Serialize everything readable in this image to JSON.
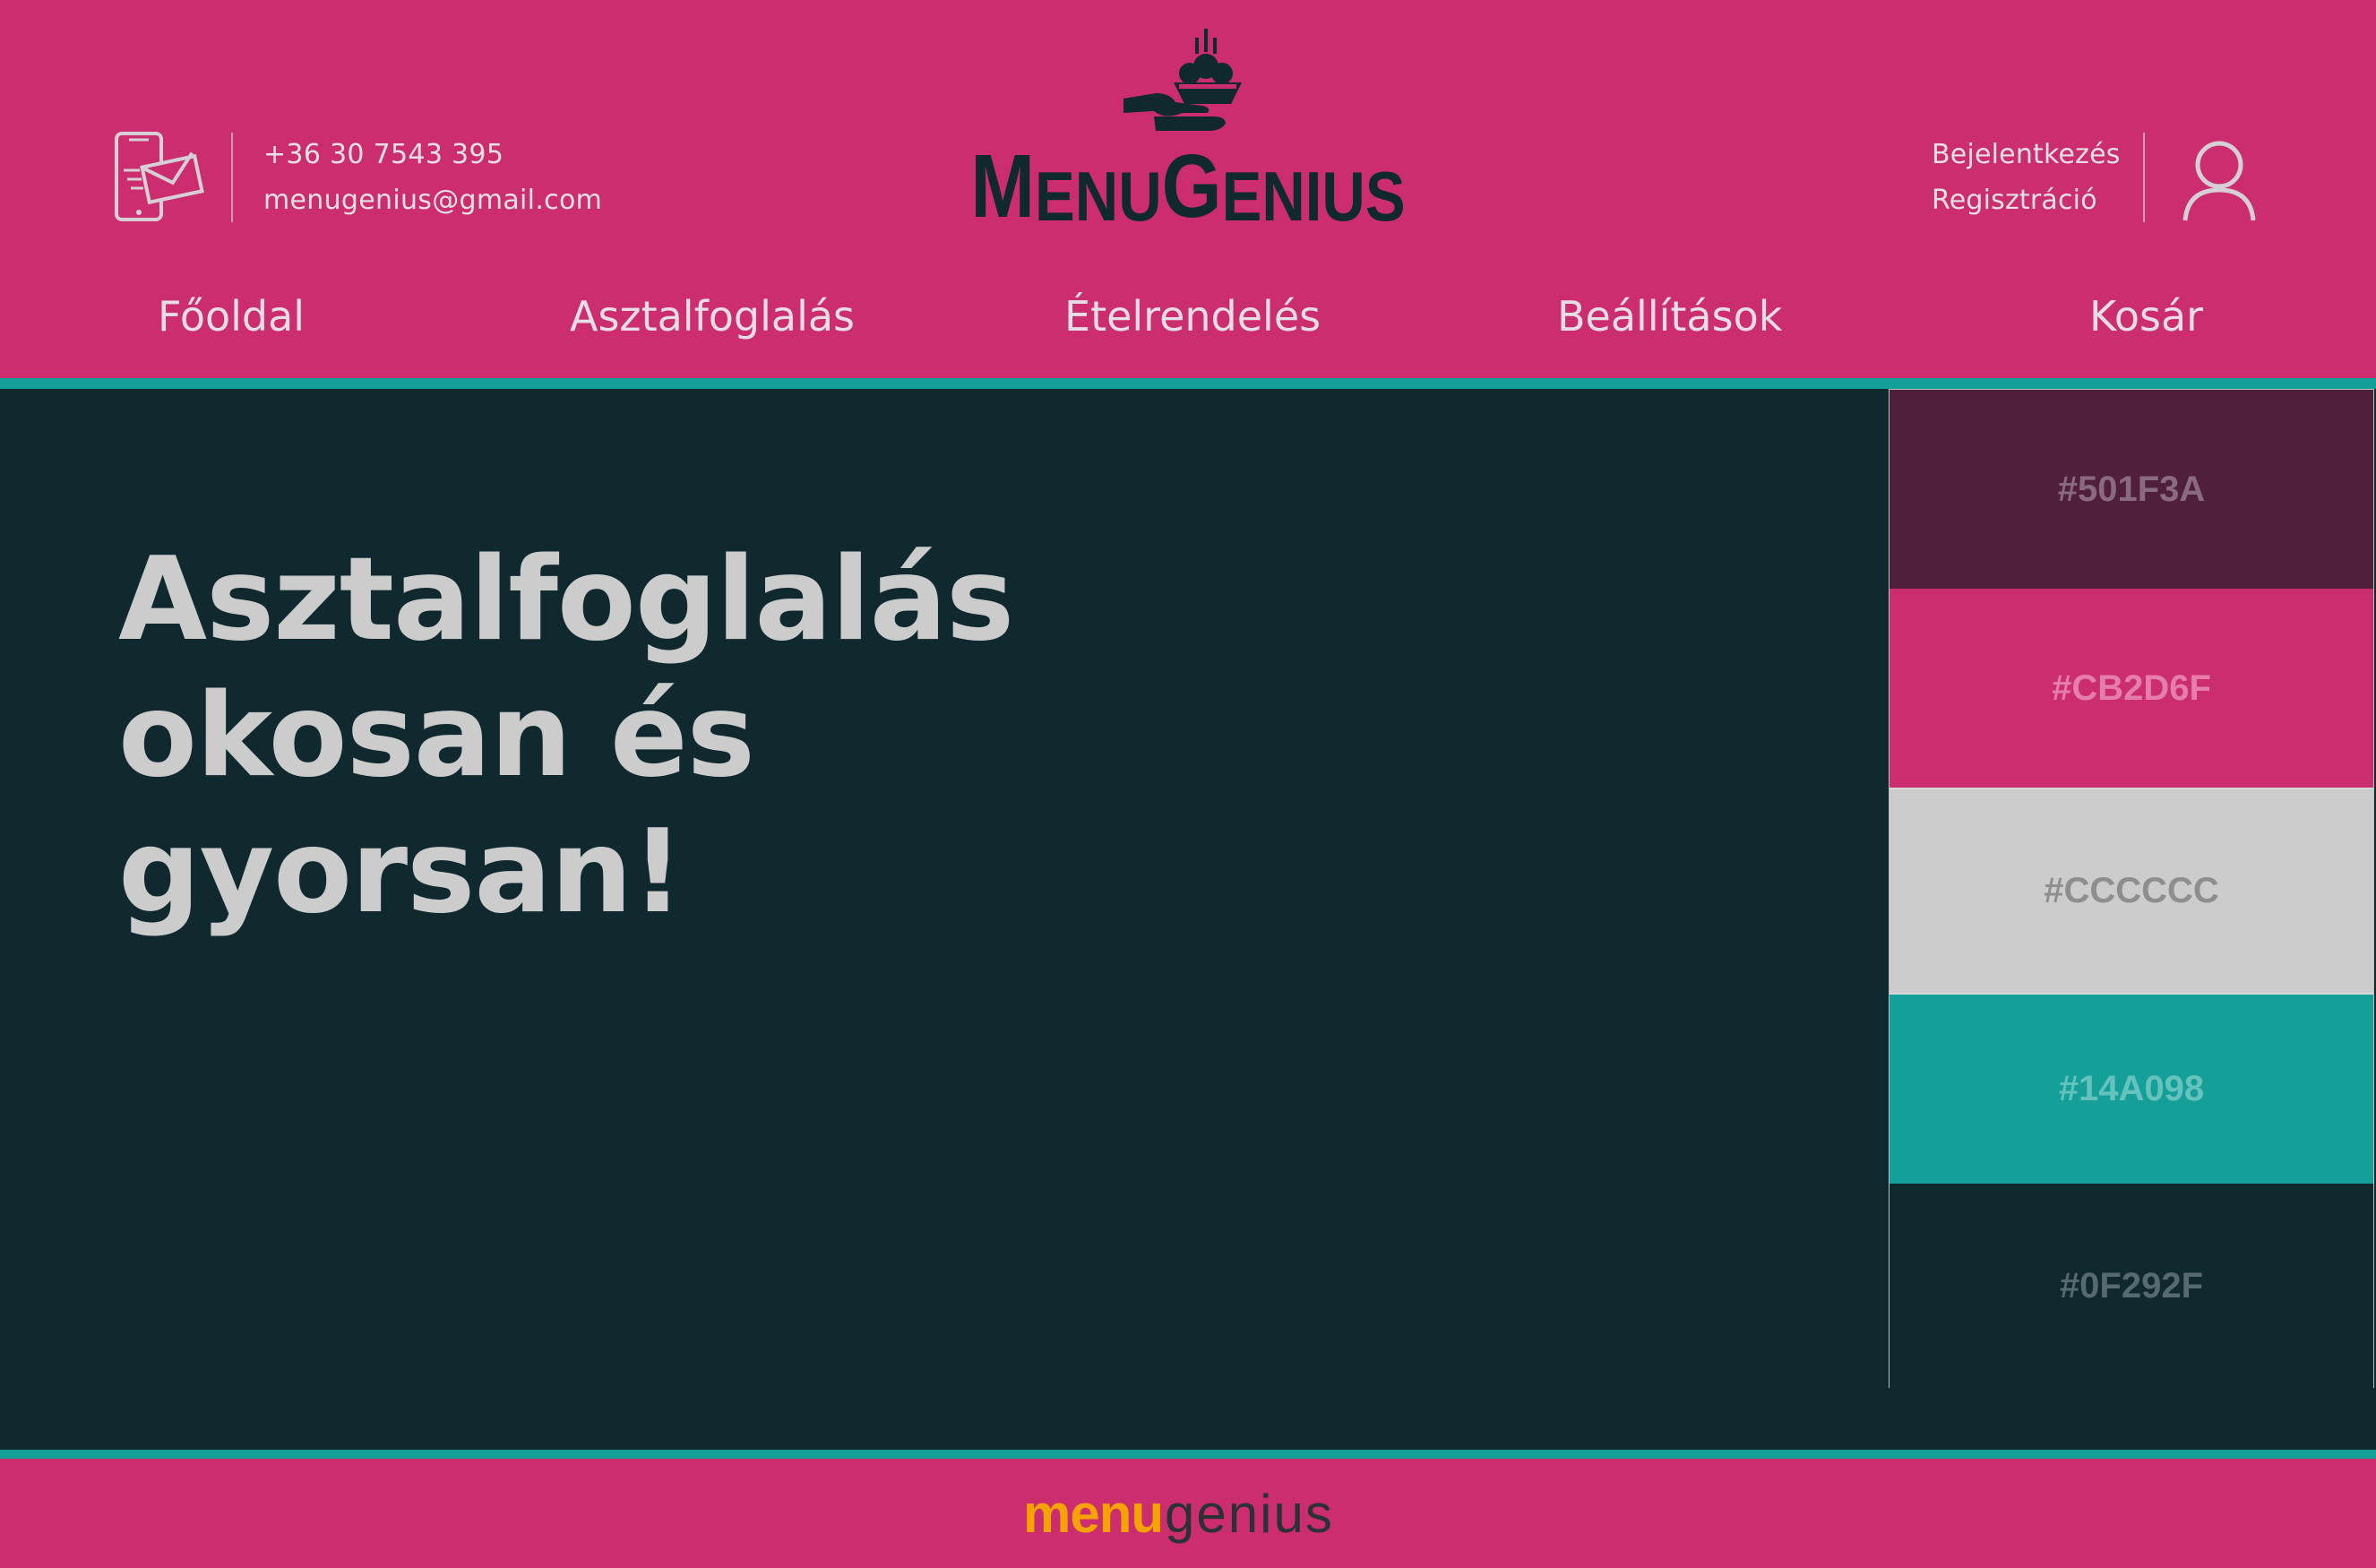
{
  "contact": {
    "phone": "+36 30 7543 395",
    "email": "menugenius@gmail.com",
    "icon": "phone-mail-icon"
  },
  "logo": {
    "text_m": "M",
    "text_enu": "ENU",
    "text_g": "G",
    "text_enius": "ENIUS",
    "icon": "serving-hand-icon",
    "color": "#0F292F"
  },
  "auth": {
    "login": "Bejelentkezés",
    "register": "Regisztráció",
    "icon": "user-icon"
  },
  "nav": [
    {
      "label": "Főoldal"
    },
    {
      "label": "Asztalfoglalás"
    },
    {
      "label": "Ételrendelés"
    },
    {
      "label": "Beállítások"
    },
    {
      "label": "Kosár"
    }
  ],
  "hero": {
    "lines": [
      "Asztalfoglalás",
      "okosan és",
      "gyorsan!"
    ]
  },
  "palette": [
    {
      "hex": "#501F3A",
      "label": "#501F3A"
    },
    {
      "hex": "#CB2D6F",
      "label": "#CB2D6F"
    },
    {
      "hex": "#CCCCCC",
      "label": "#CCCCCC"
    },
    {
      "hex": "#14A098",
      "label": "#14A098"
    },
    {
      "hex": "#0F292F",
      "label": "#0F292F"
    }
  ],
  "footer": {
    "logo_menu": "menu",
    "logo_genius": "genius",
    "menu_color": "#F5A300"
  },
  "colors": {
    "header_bg": "#CB2D6F",
    "accent": "#14A098",
    "main_bg": "#0F292F",
    "text_light": "#CCCCCC"
  }
}
